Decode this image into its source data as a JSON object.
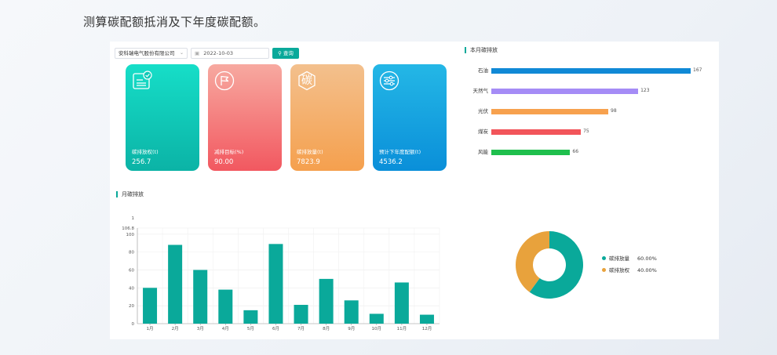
{
  "page": {
    "heading": "测算碳配额抵消及下年度碳配额。"
  },
  "toolbar": {
    "company": "安科瑞电气股份有限公司",
    "date": "2022-10-03",
    "query_label": "查询"
  },
  "cards": [
    {
      "label": "碳排放权(t)",
      "value": "256.7",
      "icon": "certificate-icon"
    },
    {
      "label": "减排目标(%)",
      "value": "90.00",
      "icon": "flag-icon"
    },
    {
      "label": "碳排放量(t)",
      "value": "7823.9",
      "icon": "carbon-badge-icon",
      "glyph": "碳"
    },
    {
      "label": "预计下年度配额(t)",
      "value": "4536.2",
      "icon": "sliders-icon"
    }
  ],
  "sections": {
    "monthly_title": "本月碳排放",
    "annual_title": "月碳排放"
  },
  "colors": {
    "teal": "#0aa99a",
    "orange": "#e8a23c",
    "bars": [
      "#1089d6",
      "#a58cf6",
      "#f7a14e",
      "#f2555a",
      "#1fbf4d"
    ]
  },
  "chart_data": [
    {
      "type": "bar",
      "orientation": "horizontal",
      "title": "本月碳排放",
      "categories": [
        "石油",
        "天然气",
        "光伏",
        "煤炭",
        "风能"
      ],
      "values": [
        167,
        123,
        98,
        75,
        66
      ]
    },
    {
      "type": "bar",
      "title": "月碳排放",
      "categories": [
        "1月",
        "2月",
        "3月",
        "4月",
        "5月",
        "6月",
        "7月",
        "8月",
        "9月",
        "10月",
        "11月",
        "12月"
      ],
      "values": [
        40,
        88,
        60,
        38,
        15,
        89,
        21,
        50,
        26,
        11,
        46,
        10
      ],
      "ylim": [
        0,
        100
      ],
      "yticks": [
        0,
        20,
        40,
        60,
        80,
        100
      ],
      "y_axis_top_labels": [
        "1",
        "106.8"
      ],
      "grid": true
    },
    {
      "type": "pie",
      "donut": true,
      "slices": [
        {
          "label": "碳排放量",
          "value": 60,
          "pct_text": "60.00%"
        },
        {
          "label": "碳排放权",
          "value": 40,
          "pct_text": "40.00%"
        }
      ],
      "legend_position": "right"
    }
  ]
}
